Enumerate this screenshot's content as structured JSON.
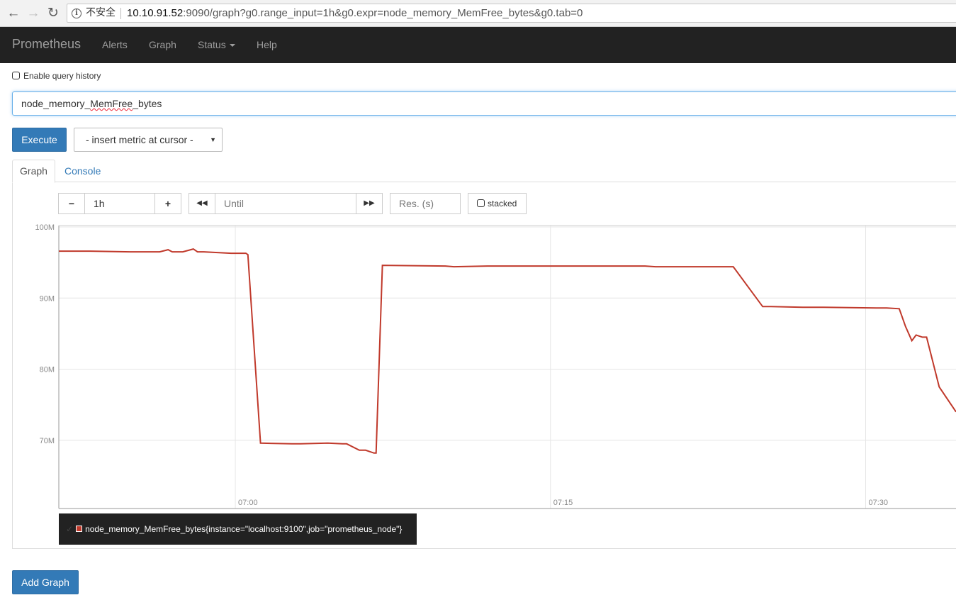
{
  "browser": {
    "insecure_label": "不安全",
    "url_host": "10.10.91.52",
    "url_rest": ":9090/graph?g0.range_input=1h&g0.expr=node_memory_MemFree_bytes&g0.tab=0"
  },
  "navbar": {
    "brand": "Prometheus",
    "items": [
      "Alerts",
      "Graph",
      "Status",
      "Help"
    ]
  },
  "history_label": "Enable query history",
  "expression": {
    "prefix": "node_memory_",
    "misspelled": "MemFree",
    "suffix": "_bytes"
  },
  "execute_label": "Execute",
  "metric_select": "- insert metric at cursor -",
  "tabs": [
    "Graph",
    "Console"
  ],
  "controls": {
    "minus": "−",
    "range": "1h",
    "plus": "+",
    "back": "◀◀",
    "until_placeholder": "Until",
    "forward": "▶▶",
    "resolution_placeholder": "Res. (s)",
    "stacked": "stacked"
  },
  "legend": "node_memory_MemFree_bytes{instance=\"localhost:9100\",job=\"prometheus_node\"}",
  "add_graph_label": "Add Graph",
  "colors": {
    "line": "#c0392b",
    "primary": "#337ab7",
    "navbar": "#222222"
  },
  "chart_data": {
    "type": "line",
    "x_tick_labels": [
      "07:00",
      "07:15",
      "07:30"
    ],
    "x_tick_minutes": [
      0,
      15,
      30
    ],
    "y_tick_labels": [
      "100M",
      "90M",
      "80M",
      "70M"
    ],
    "y_tick_values": [
      100,
      90,
      80,
      70
    ],
    "ylim": [
      60.4,
      100.2
    ],
    "xlim_minutes": [
      -8.4,
      34.3
    ],
    "grid": true,
    "series": [
      {
        "name": "node_memory_MemFree_bytes{instance=\"localhost:9100\",job=\"prometheus_node\"}",
        "x_minutes": [
          -8.4,
          -6.9,
          -5.0,
          -3.6,
          -3.2,
          -3.0,
          -2.5,
          -2.0,
          -1.8,
          -1.5,
          -0.2,
          0.2,
          0.5,
          0.6,
          1.2,
          2.7,
          3.1,
          4.4,
          5.1,
          5.3,
          5.9,
          6.2,
          6.6,
          6.7,
          7.0,
          10.0,
          10.4,
          12.0,
          14.0,
          15.0,
          17.0,
          19.5,
          20.0,
          23.0,
          23.7,
          25.1,
          25.5,
          27.0,
          28.0,
          30.5,
          31.0,
          31.6,
          31.9,
          32.2,
          32.4,
          32.7,
          32.9,
          33.5,
          34.3
        ],
        "values_M": [
          96.6,
          96.6,
          96.5,
          96.5,
          96.8,
          96.5,
          96.5,
          96.9,
          96.5,
          96.5,
          96.3,
          96.3,
          96.3,
          96.1,
          69.6,
          69.5,
          69.5,
          69.6,
          69.5,
          69.5,
          68.6,
          68.6,
          68.2,
          68.2,
          94.6,
          94.5,
          94.4,
          94.5,
          94.5,
          94.5,
          94.5,
          94.5,
          94.4,
          94.4,
          94.4,
          88.8,
          88.8,
          88.7,
          88.7,
          88.6,
          88.6,
          88.5,
          86.0,
          84.0,
          84.8,
          84.5,
          84.5,
          77.5,
          74.0
        ]
      }
    ]
  }
}
